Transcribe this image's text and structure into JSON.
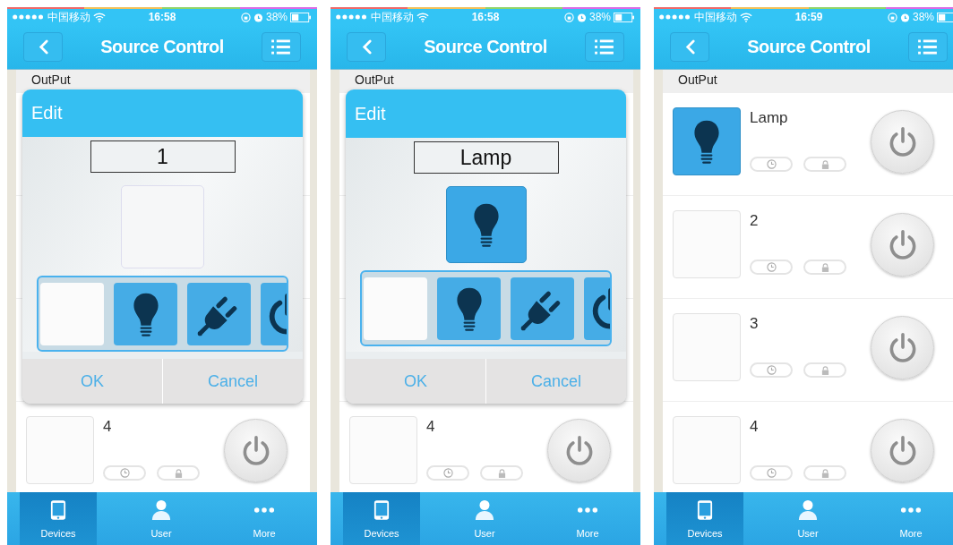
{
  "screens": [
    {
      "status_bar": {
        "carrier": "中国移动",
        "time": "16:58",
        "battery": "38%"
      },
      "nav_bar": {
        "title": "Source Control"
      },
      "section": {
        "title": "OutPut"
      },
      "devices": [
        {
          "name": "4",
          "kind": "empty"
        }
      ],
      "dialog": {
        "title": "Edit",
        "name_value": "1",
        "preview": {
          "kind": "empty"
        },
        "choices": [
          {
            "kind": "empty"
          },
          {
            "kind": "bulb"
          },
          {
            "kind": "plug"
          },
          {
            "kind": "power"
          }
        ],
        "buttons": [
          "OK",
          "Cancel"
        ]
      },
      "tabs": [
        {
          "label": "Devices",
          "kind": "phone",
          "selected": true
        },
        {
          "label": "User",
          "kind": "user",
          "selected": false
        },
        {
          "label": "More",
          "kind": "more",
          "selected": false
        }
      ]
    },
    {
      "status_bar": {
        "carrier": "中国移动",
        "time": "16:58",
        "battery": "38%"
      },
      "nav_bar": {
        "title": "Source Control"
      },
      "section": {
        "title": "OutPut"
      },
      "devices": [
        {
          "name": "4",
          "kind": "empty"
        }
      ],
      "dialog": {
        "title": "Edit",
        "name_value": "Lamp",
        "preview": {
          "kind": "bulb"
        },
        "choices": [
          {
            "kind": "empty"
          },
          {
            "kind": "bulb"
          },
          {
            "kind": "plug"
          },
          {
            "kind": "power"
          }
        ],
        "buttons": [
          "OK",
          "Cancel"
        ]
      },
      "tabs": [
        {
          "label": "Devices",
          "kind": "phone",
          "selected": true
        },
        {
          "label": "User",
          "kind": "user",
          "selected": false
        },
        {
          "label": "More",
          "kind": "more",
          "selected": false
        }
      ]
    },
    {
      "status_bar": {
        "carrier": "中国移动",
        "time": "16:59",
        "battery": "38%"
      },
      "nav_bar": {
        "title": "Source Control"
      },
      "section": {
        "title": "OutPut"
      },
      "devices": [
        {
          "name": "Lamp",
          "kind": "bulb"
        },
        {
          "name": "2",
          "kind": "empty"
        },
        {
          "name": "3",
          "kind": "empty"
        },
        {
          "name": "4",
          "kind": "empty"
        }
      ],
      "tabs": [
        {
          "label": "Devices",
          "kind": "phone",
          "selected": true
        },
        {
          "label": "User",
          "kind": "user",
          "selected": false
        },
        {
          "label": "More",
          "kind": "more",
          "selected": false
        }
      ]
    }
  ]
}
